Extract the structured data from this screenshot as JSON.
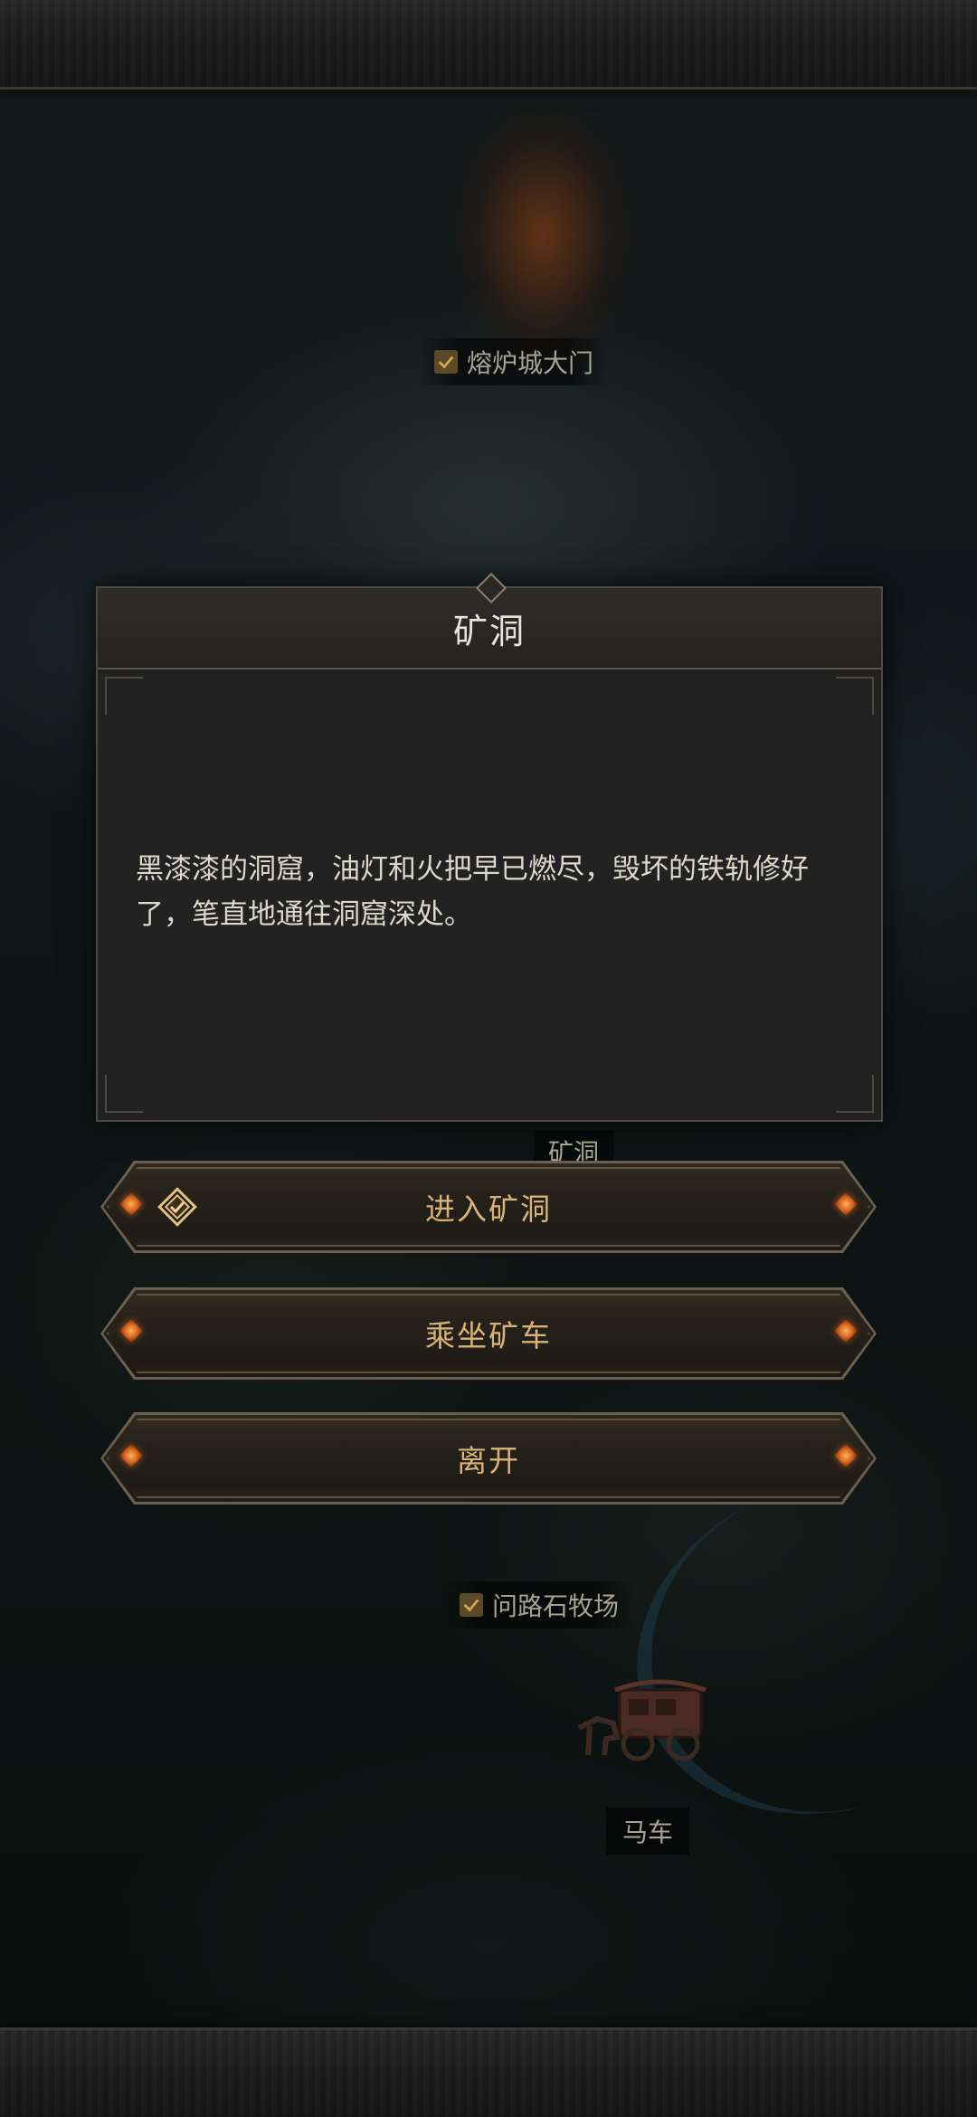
{
  "map": {
    "labels": {
      "furnace_gate": "熔炉城大门",
      "mine": "矿洞",
      "ranch": "问路石牧场",
      "carriage": "马车"
    }
  },
  "dialog": {
    "title": "矿洞",
    "description": "黑漆漆的洞窟，油灯和火把早已燃尽，毁坏的铁轨修好了，笔直地通往洞窟深处。"
  },
  "actions": [
    {
      "label": "进入矿洞",
      "icon": "quest-marker-icon"
    },
    {
      "label": "乘坐矿车"
    },
    {
      "label": "离开"
    }
  ],
  "colors": {
    "accent_gold": "#d8b278",
    "gem_orange": "#d4601c",
    "dialog_bg": "#222223"
  }
}
